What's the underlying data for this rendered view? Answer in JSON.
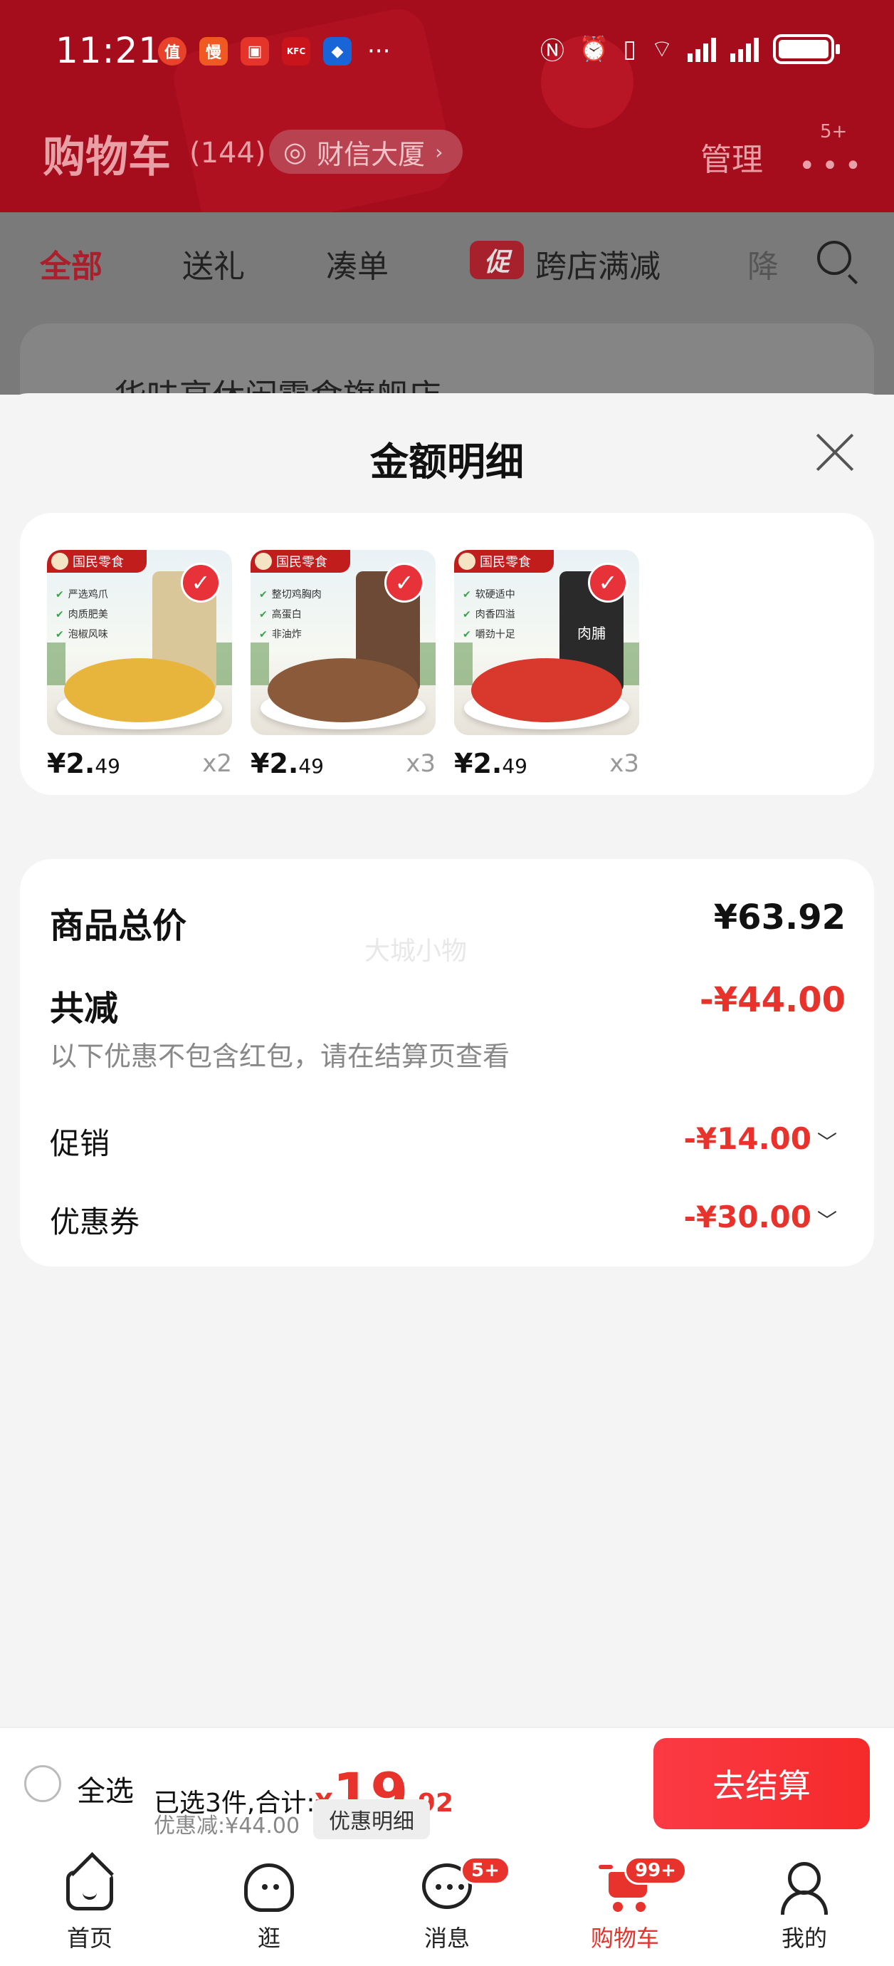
{
  "status_bar": {
    "time": "11:21",
    "app_icons": [
      "值",
      "慢",
      "▣",
      "KFC",
      "◆"
    ],
    "more": "···",
    "system_icons": [
      "nfc-icon",
      "alarm-icon",
      "vibrate-icon",
      "wifi-6-icon",
      "signal-icon",
      "signal-icon",
      "battery-icon"
    ]
  },
  "header": {
    "title": "购物车",
    "count": "(144)",
    "location": "财信大厦",
    "manage": "管理",
    "more_badge": "5+"
  },
  "tabs": {
    "all": "全部",
    "gift": "送礼",
    "bundle": "凑单",
    "promo_tag": "促",
    "cross_store": "跨店满减",
    "next": "降"
  },
  "shop": {
    "name": "华味亨休闲零食旗舰店"
  },
  "sheet": {
    "title": "金额明细",
    "watermark": "大城小物"
  },
  "items": [
    {
      "brand": "国民零食",
      "features": [
        "严选鸡爪",
        "肉质肥美",
        "泡椒风味"
      ],
      "price_main": "¥2.",
      "price_cents": "49",
      "qty": "x2",
      "food_color": "#e7b53c",
      "pack_color": "#d9c79a"
    },
    {
      "brand": "国民零食",
      "features": [
        "整切鸡胸肉",
        "高蛋白",
        "非油炸"
      ],
      "price_main": "¥2.",
      "price_cents": "49",
      "qty": "x3",
      "food_color": "#8a5a3a",
      "pack_color": "#6d4a36"
    },
    {
      "brand": "国民零食",
      "features": [
        "软硬适中",
        "肉香四溢",
        "嚼劲十足"
      ],
      "price_main": "¥2.",
      "price_cents": "49",
      "qty": "x3",
      "food_color": "#d8392c",
      "pack_color": "#2a2a2a",
      "pack_label": "肉脯"
    }
  ],
  "summary": {
    "total_label": "商品总价",
    "total_value": "¥63.92",
    "reduce_label": "共减",
    "reduce_value": "-¥44.00",
    "hint": "以下优惠不包含红包，请在结算页查看",
    "promo_label": "促销",
    "promo_value": "-¥14.00",
    "coupon_label": "优惠券",
    "coupon_value": "-¥30.00"
  },
  "checkout": {
    "select_all": "全选",
    "selected_text": "已选3件,合计:",
    "yen": "¥",
    "total_int": "19",
    "total_dec": ".92",
    "discount_text": "优惠减:¥44.00",
    "detail_button": "优惠明细",
    "checkout_button": "去结算"
  },
  "nav": {
    "home": "首页",
    "browse": "逛",
    "messages": "消息",
    "messages_badge": "5+",
    "cart": "购物车",
    "cart_badge": "99+",
    "me": "我的"
  },
  "colors": {
    "header_red": "#a50d1c",
    "accent_red": "#e8322c",
    "checkout_button": "#f52a2a"
  }
}
